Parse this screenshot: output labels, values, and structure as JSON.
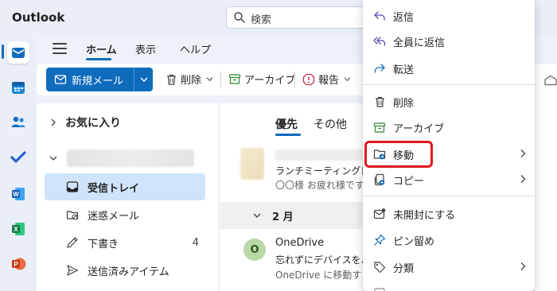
{
  "app": {
    "title": "Outlook"
  },
  "search": {
    "placeholder": "検索"
  },
  "ribbon": {
    "tabs": [
      {
        "label": "ホーム",
        "active": true
      },
      {
        "label": "表示",
        "active": false
      },
      {
        "label": "ヘルプ",
        "active": false
      }
    ],
    "new_mail_label": "新規メール",
    "delete_label": "削除",
    "archive_label": "アーカイブ",
    "report_label": "報告"
  },
  "folders": {
    "favorites_label": "お気に入り",
    "items": [
      {
        "label": "受信トレイ",
        "count": "",
        "selected": true,
        "icon": "inbox-icon"
      },
      {
        "label": "迷惑メール",
        "count": "",
        "selected": false,
        "icon": "junk-icon"
      },
      {
        "label": "下書き",
        "count": "4",
        "selected": false,
        "icon": "draft-icon"
      },
      {
        "label": "送信済みアイテム",
        "count": "",
        "selected": false,
        "icon": "send-icon"
      }
    ]
  },
  "message_list": {
    "pivots": [
      {
        "label": "優先",
        "active": true
      },
      {
        "label": "その他",
        "active": false
      }
    ],
    "messages": [
      {
        "subject": "ランチミーティング日程",
        "preview": "〇〇様 お疲れ様です"
      }
    ],
    "group_label": "2 月",
    "onedrive": {
      "avatar_letter": "O",
      "sender": "OneDrive",
      "subject": "忘れずにデバイスをバ",
      "preview": "OneDrive に移動す"
    }
  },
  "context_menu": {
    "items": [
      {
        "label": "返信",
        "icon": "reply-icon"
      },
      {
        "label": "全員に返信",
        "icon": "reply-all-icon"
      },
      {
        "label": "転送",
        "icon": "forward-icon"
      },
      {
        "label": "削除",
        "icon": "delete-icon"
      },
      {
        "label": "アーカイブ",
        "icon": "archive-icon"
      },
      {
        "label": "移動",
        "icon": "move-folder-icon",
        "submenu": true,
        "highlighted": true
      },
      {
        "label": "コピー",
        "icon": "copy-icon",
        "submenu": true
      },
      {
        "label": "未開封にする",
        "icon": "mark-unread-icon"
      },
      {
        "label": "ピン留め",
        "icon": "pin-icon"
      },
      {
        "label": "分類",
        "icon": "tag-icon",
        "submenu": true
      }
    ]
  },
  "colors": {
    "accent": "#0f6cbd",
    "selected_folder": "#cfe4fa",
    "highlight_box": "#e0191e",
    "purple_icon": "#5b4bb7"
  }
}
